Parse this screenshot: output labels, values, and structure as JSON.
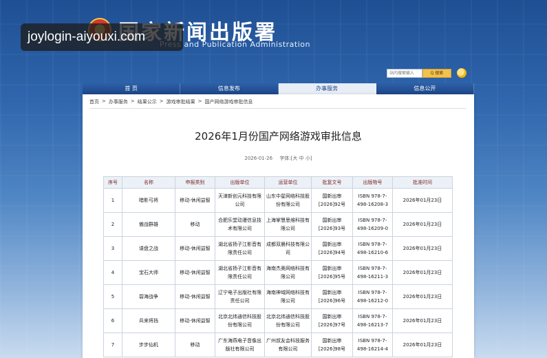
{
  "header": {
    "site_title": "国家新闻出版署",
    "site_subtitle": "Press and Publication Administration",
    "watermark": "joylogin-aiyouxi.com",
    "search_placeholder": "站内搜索输入",
    "search_button": "Q 搜索"
  },
  "nav": {
    "items": [
      "首 页",
      "信息发布",
      "办事服务",
      "信息公开"
    ]
  },
  "breadcrumb": [
    "首页",
    ">",
    "办事服务",
    ">",
    "结果公示",
    ">",
    "游戏审批结果",
    ">",
    "国产网络游戏审批信息"
  ],
  "article": {
    "title": "2026年1月份国产网络游戏审批信息",
    "date": "2026-01-26",
    "font_size_label": "字体:[大 中 小]"
  },
  "table": {
    "headers": [
      "序号",
      "名称",
      "申报类别",
      "出版单位",
      "运营单位",
      "批复文号",
      "出版物号",
      "批准时间"
    ],
    "rows": [
      [
        "1",
        "暗影弓将",
        "移动-休闲益智",
        "天津新创元科技有限公司",
        "山东中星网络科技股份有限公司",
        "国新出审[2026]92号",
        "ISBN 978-7-498-16208-3",
        "2026年01月23日"
      ],
      [
        "2",
        "傲战群雄",
        "移动",
        "合肥乐堂动漫信息技术有限公司",
        "上海掌慧思维科技有限公司",
        "国新出审[2026]93号",
        "ISBN 978-7-498-16209-0",
        "2026年01月23日"
      ],
      [
        "3",
        "谍盘之战",
        "移动-休闲益智",
        "湖北省扬子江影音有限责任公司",
        "成都双晨科技有限公司",
        "国新出审[2026]94号",
        "ISBN 978-7-498-16210-6",
        "2026年01月23日"
      ],
      [
        "4",
        "宝石大师",
        "移动-休闲益智",
        "湖北省扬子江影音有限责任公司",
        "海南杰奥网络科技有限公司",
        "国新出审[2026]95号",
        "ISBN 978-7-498-16211-3",
        "2026年01月23日"
      ],
      [
        "5",
        "碧海战争",
        "移动-休闲益智",
        "辽宁电子出版社有限责任公司",
        "海南神域网络科技有限公司",
        "国新出审[2026]96号",
        "ISBN 978-7-498-16212-0",
        "2026年01月23日"
      ],
      [
        "6",
        "兵来将挡",
        "移动-休闲益智",
        "北京北纬通信科技股份有限公司",
        "北京北纬通信科技股份有限公司",
        "国新出审[2026]97号",
        "ISBN 978-7-498-16213-7",
        "2026年01月23日"
      ],
      [
        "7",
        "步步仙机",
        "移动",
        "广东海燕电子音像出版社有限公司",
        "广州叔友会科技服务有限公司",
        "国新出审[2026]98号",
        "ISBN 978-7-498-16214-4",
        "2026年01月23日"
      ]
    ]
  }
}
